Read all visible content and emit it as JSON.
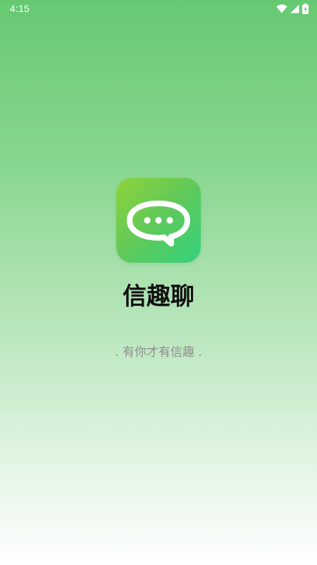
{
  "status_bar": {
    "time": "4:15",
    "icons": [
      "wifi-icon",
      "signal-icon",
      "battery-charging-icon"
    ]
  },
  "splash": {
    "app_icon": "chat-bubble-icon",
    "app_name": "信趣聊",
    "slogan": ". 有你才有信趣 ."
  },
  "colors": {
    "gradient_top": "#66c972",
    "gradient_bottom": "#ffffff",
    "icon_gradient_start": "#8fd33a",
    "icon_gradient_end": "#33d27c",
    "title": "#111111",
    "slogan": "#8e8e8e"
  }
}
